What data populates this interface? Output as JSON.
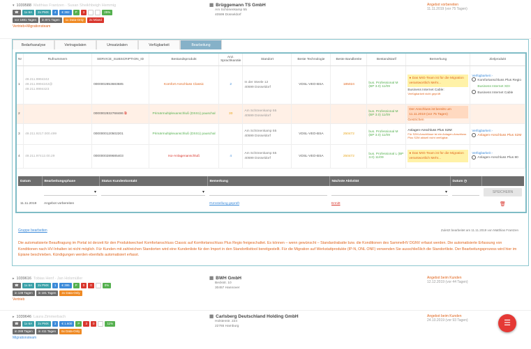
{
  "records": [
    {
      "id": "1039588",
      "contact": "Matthias Frantzen · Susan Sheikhbeigh Hemmig",
      "badges1": [
        {
          "text": "1x 6A",
          "color": "teal"
        },
        {
          "text": "2x PMX",
          "color": "teal"
        },
        {
          "text": "4",
          "color": "blue"
        },
        {
          "text": "€ 382",
          "color": "blue"
        },
        {
          "text": "P",
          "color": "green"
        },
        {
          "text": "3",
          "color": "red"
        },
        {
          "text": "",
          "color": "white"
        },
        {
          "text": "",
          "color": "white"
        },
        {
          "text": "25%",
          "color": "green"
        }
      ],
      "badges2": [
        {
          "text": "vor 1881 Tagen",
          "color": "gray"
        },
        {
          "text": "in 871 Tagen",
          "color": "gray"
        },
        {
          "text": "1x Data-Only",
          "color": "orange"
        },
        {
          "text": "2x Mixed",
          "color": "orange"
        }
      ],
      "team": "Vertrieb+Migrationsteam",
      "company": "Brüggemann TS GmbH",
      "address": [
        "Am Schönenkamp 55",
        "40599 Düsseldorf"
      ],
      "status": "Angebot vorbereiten",
      "status_sub": "11.11.2019 (vor 75 Tagen)"
    },
    {
      "id": "1039616",
      "contact": "Tobias Henf · Jan Holsmüller",
      "badges1": [
        {
          "text": "1x 6A",
          "color": "teal"
        },
        {
          "text": "2x PMX",
          "color": "teal"
        },
        {
          "text": "1",
          "color": "blue"
        },
        {
          "text": "€ 395",
          "color": "blue"
        },
        {
          "text": "P",
          "color": "green"
        },
        {
          "text": "0",
          "color": "red"
        },
        {
          "text": "0",
          "color": "red"
        },
        {
          "text": "",
          "color": "white"
        },
        {
          "text": "0%",
          "color": "green"
        }
      ],
      "badges2": [
        {
          "text": "in 138 Tagen",
          "color": "gray"
        },
        {
          "text": "in 181 Tagen",
          "color": "gray"
        },
        {
          "text": "2x Data-Only",
          "color": "orange"
        }
      ],
      "team": "Vertrieb",
      "company": "BWH GmbH",
      "address": [
        "Beckstr. 10",
        "30457 Hannover"
      ],
      "status": "Angebot beim Kunden",
      "status_sub": "12.12.2019 (vor 44 Tagen)"
    },
    {
      "id": "1039646",
      "contact": "Laura Zimmerbach",
      "badges1": [
        {
          "text": "1x 6A",
          "color": "teal"
        },
        {
          "text": "2x PMX",
          "color": "teal"
        },
        {
          "text": "3",
          "color": "blue"
        },
        {
          "text": "€ 1.600",
          "color": "blue"
        },
        {
          "text": "P",
          "color": "green"
        },
        {
          "text": "3",
          "color": "red"
        },
        {
          "text": "0",
          "color": "red"
        },
        {
          "text": "",
          "color": "white"
        },
        {
          "text": "11%",
          "color": "green"
        }
      ],
      "badges2": [
        {
          "text": "in 288 Tagen",
          "color": "gray"
        },
        {
          "text": "in 411 Tagen",
          "color": "gray"
        },
        {
          "text": "6x Data-Only",
          "color": "orange"
        }
      ],
      "team": "Migrationsteam",
      "company": "Carlsberg Deutschland Holding GmbH",
      "address": [
        "Holstenstr. 224",
        "22765 Hamburg"
      ],
      "status": "Angebot beim Kunden",
      "status_sub": "24.10.2019 (vor 93 Tagen)"
    }
  ],
  "tabs": [
    "Bedarfsanalyse",
    "Vertragsdaten",
    "Umsatzdaten",
    "Verfügbarkeit",
    "Bearbeitung"
  ],
  "product_table": {
    "headers": [
      "Nr",
      "Rufnummern",
      "SERVICE_SUBSCRIPTION_ID",
      "Bestandsprodukt",
      "Anz. Sprachkanäle",
      "Standort",
      "Beste Technologie",
      "Beste Bandbreite",
      "Bestandstarif",
      "Bemerkung",
      "Zielprodukt"
    ],
    "rows": [
      {
        "nr": "1",
        "phones": [
          "49.211.9994242",
          "49.211.9994242@",
          "49.211.9994423"
        ],
        "ssid": "0000002853683685",
        "product": "Komfort-Anschluss Classic",
        "channels": "2",
        "site": [
          "In der Steele 12",
          "40599 Düsseldorf"
        ],
        "tech": "VDSL-VEO-BSA",
        "bw": "185024",
        "tariff": "bus. Professional M (BP 3.0) 11/09",
        "note_warn": "Das MIG-Team ist für die Migration verantwortlich Mehr...",
        "note_text": "Business Internet Cable:",
        "note_sub": "Verfügbarkeit nicht geprüft",
        "target_label": "Verfügbarkeit",
        "targets": [
          "Komfortanschluss Plus Regio",
          "Business Internet XDI",
          "Business Internet Cable"
        ]
      },
      {
        "nr": "2",
        "phones": [],
        "ssid": "0000002832768486",
        "product": "Primärmultiplexanschluß (DSS1) pauschal",
        "channels": "30",
        "site": [
          "Am Schönenkamp 55",
          "40599 Düsseldorf"
        ],
        "tech": "",
        "bw": "",
        "tariff": "bus. Professional M (BP 3.0) 11/09",
        "note_warn": "Der Anschluss ist bereits um 11.11.2019 (vor 75 Tagen)",
        "note_text": "Gestrichen",
        "note_sub": "",
        "target_label": "",
        "targets": []
      },
      {
        "nr": "3",
        "phones": [
          "49.211.9217.000.499"
        ],
        "ssid": "0000000120502201",
        "product": "Primärmultiplexanschluß (DSS1) pauschal",
        "channels": "",
        "site": [
          "Am Schönenkamp 55",
          "40599 Düsseldorf"
        ],
        "tech": "VDSL-VEO-BSA",
        "bw": "250472",
        "tariff": "bus. Professional M (BP 3.0) 11/09",
        "note_warn": "",
        "note_text": "Anlagen-Anschluss Plus S2M:",
        "note_sub": "Für S2M-Anschlüsse ist ein Anlagen-Anschluss Plus S2M aktuell nicht verfügbar.",
        "target_label": "Verfügbarkeit",
        "targets": [
          "Anlagen-Anschluss Plus S2M"
        ]
      },
      {
        "nr": "4",
        "phones": [
          "49.211.97412.00.29"
        ],
        "ssid": "0000000289685403",
        "product": "Iso-Anlagenanschluß",
        "channels": "4",
        "site": [
          "Am Schönenkamp 55",
          "40599 Düsseldorf"
        ],
        "tech": "VDSL-VEO-BSA",
        "bw": "250472",
        "tariff": "bus. Professional L (BP 3.0) 11/09",
        "note_warn": "Das MIG-Team ist für die Migration verantwortlich Mehr...",
        "note_text": "",
        "note_sub": "",
        "target_label": "Verfügbarkeit",
        "targets": [
          "Anlagen-Anschluss Plus 80"
        ]
      }
    ]
  },
  "activity_table": {
    "headers": [
      "Datum",
      "Bearbeitungsphase",
      "Status Kundenkontakt",
      "Bemerkung",
      "Nächste Aktivität",
      "Datum"
    ],
    "save_label": "SPEICHERN",
    "row": {
      "date": "11.11.2019",
      "phase": "Angebot vorbereiten",
      "status": "",
      "remark": "#Umstellung geprüft",
      "next": "Ermitt",
      "next_date": ""
    }
  },
  "edit_group": "Gruppe bearbeiten",
  "last_modified": "Zuletzt bearbeitet am 11.11.2019 von Matthias Frantzen",
  "info_text": "Die automatisierte Beauftragung im Portal ist derzeit für den Produktwechsel Komfortanschluss Classic auf Komfortanschluss Plus Regio freigeschaltet. Es können – wenn gewünscht – Standardrabatte bzw. die Konditionen des SammelHV DGNV erfasst werden. Die automatisierte Erfassung von Konditionen nach HV-Inhalten ist nicht möglich. Für Kunden mit zahlreichen Standorten wird eine Kundenliste für den Import in den Standortlisttool bereitgestellt. Für die Migration auf Werkstattprodukte (IP-N, ONL ONF) verwenden Sie ausschließlich die Standortliste. Der Bearbeitungsprozess wird hier im Epiane beschrieben. Kündigungen werden ebenfalls automatisiert erfasst.",
  "fab_icon": "menu-icon"
}
